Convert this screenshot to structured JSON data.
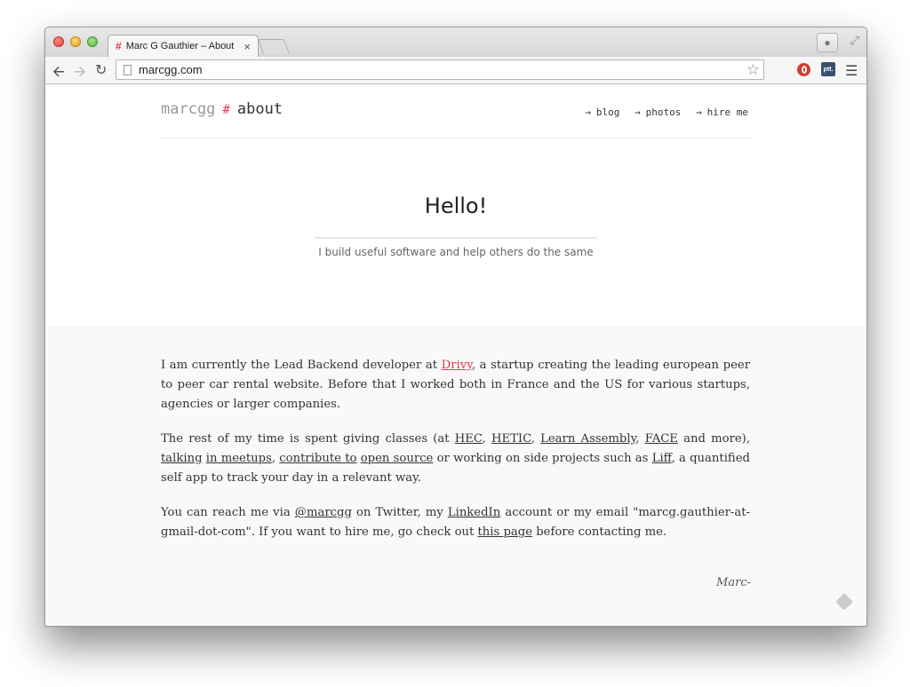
{
  "browser": {
    "tab_title": "Marc G Gauthier – About",
    "tab_favicon": "#",
    "tab_close": "×",
    "url": "marcgg.com",
    "ext_label": "ptt."
  },
  "site": {
    "brand_name": "marcgg",
    "brand_hash": "#",
    "brand_section": "about",
    "nav": [
      {
        "label": "blog"
      },
      {
        "label": "photos"
      },
      {
        "label": "hire me"
      }
    ]
  },
  "hero": {
    "title": "Hello!",
    "tagline": "I build useful software and help others do the same"
  },
  "body": {
    "p1": {
      "pre": "I am currently the Lead Backend developer at ",
      "link": "Drivy",
      "post": ", a startup creating the leading european peer to peer car rental website. Before that I worked both in France and the US for various startups, agencies or larger companies."
    },
    "p2": {
      "t1": "The rest of my time is spent giving classes (at ",
      "l_hec": "HEC",
      "t2": ", ",
      "l_hetic": "HETIC",
      "t3": ", ",
      "l_learn": "Learn Assembly",
      "t4": ", ",
      "l_face": "FACE",
      "t5": " and more), ",
      "l_talking": "talking",
      "t6": " ",
      "l_meetups": "in meetups",
      "t7": ", ",
      "l_contribute": "contribute to",
      "t8": " ",
      "l_opensource": "open source",
      "t9": " or working on side projects such as ",
      "l_liff": "Liff",
      "t10": ", a quantified self app to track your day in a relevant way."
    },
    "p3": {
      "t1": "You can reach me via ",
      "l_twitter": "@marcgg",
      "t2": " on Twitter, my ",
      "l_linkedin": "LinkedIn",
      "t3": " account or my email \"marcg.gauthier-at-gmail-dot-com\". If you want to hire me, go check out ",
      "l_thispage": "this page",
      "t4": " before contacting me."
    },
    "signoff": "Marc-"
  },
  "colors": {
    "accent": "#e53a4e",
    "content_bg": "#f9f9f9"
  }
}
